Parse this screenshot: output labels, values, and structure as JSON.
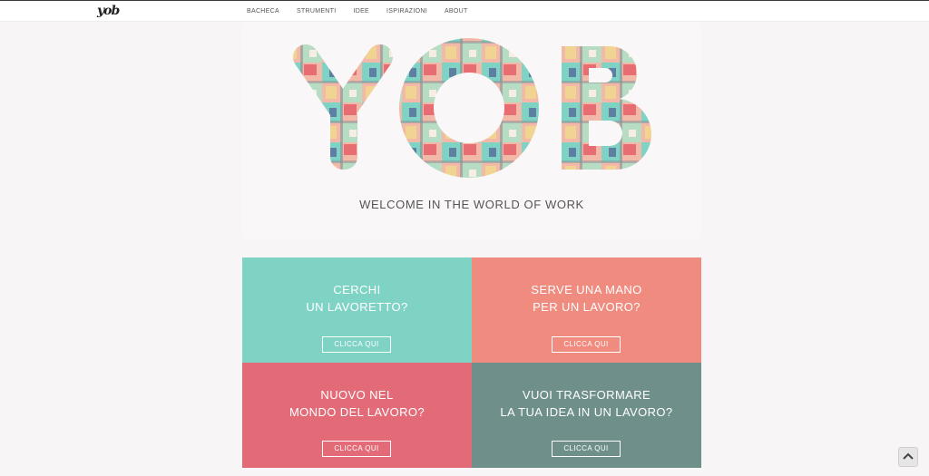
{
  "nav": {
    "logo": "yob",
    "items": [
      "BACHECA",
      "STRUMENTI",
      "IDEE",
      "ISPIRAZIONI",
      "ABOUT"
    ]
  },
  "hero": {
    "logo_text": "YOB",
    "tagline": "WELCOME IN THE WORLD OF WORK"
  },
  "tiles": [
    {
      "line1": "CERCHI",
      "line2": "UN LAVORETTO?",
      "button": "CLICCA QUI",
      "color": "#7fd3c4"
    },
    {
      "line1": "SERVE UNA MANO",
      "line2": "PER UN LAVORO?",
      "button": "CLICCA QUI",
      "color": "#ef8b7f"
    },
    {
      "line1": "NUOVO NEL",
      "line2": "MONDO DEL LAVORO?",
      "button": "CLICCA QUI",
      "color": "#e36b77"
    },
    {
      "line1": "VUOI TRASFORMARE",
      "line2": "LA TUA IDEA IN UN LAVORO?",
      "button": "CLICCA QUI",
      "color": "#6f8f8b"
    }
  ],
  "icons": {
    "scroll_top": "chevron-up-icon"
  }
}
